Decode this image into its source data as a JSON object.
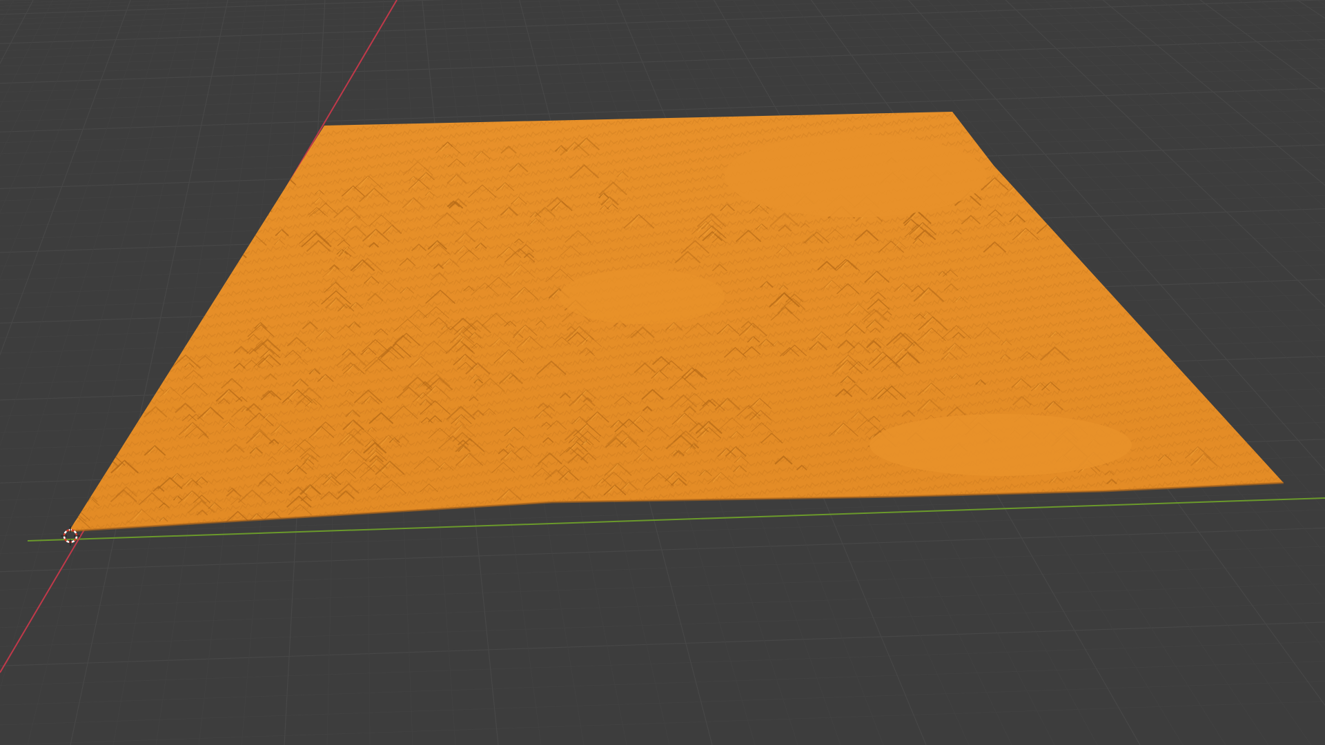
{
  "viewport": {
    "background_color": "#3d3d3d",
    "grid_color": "#474747",
    "grid_minor_color": "#424242",
    "x_axis_color": "#c0394a",
    "y_axis_color": "#6b9a2b"
  },
  "terrain": {
    "object_type": "mesh",
    "state": "selected",
    "shading": "solid",
    "color": "#e8912a",
    "shadow_color": "#b66a17",
    "highlight_color": "#f4a63c"
  },
  "cursor_3d": {
    "icon": "3d-cursor-icon",
    "ring_color_a": "#ffffff",
    "ring_color_b": "#d33a2c"
  }
}
